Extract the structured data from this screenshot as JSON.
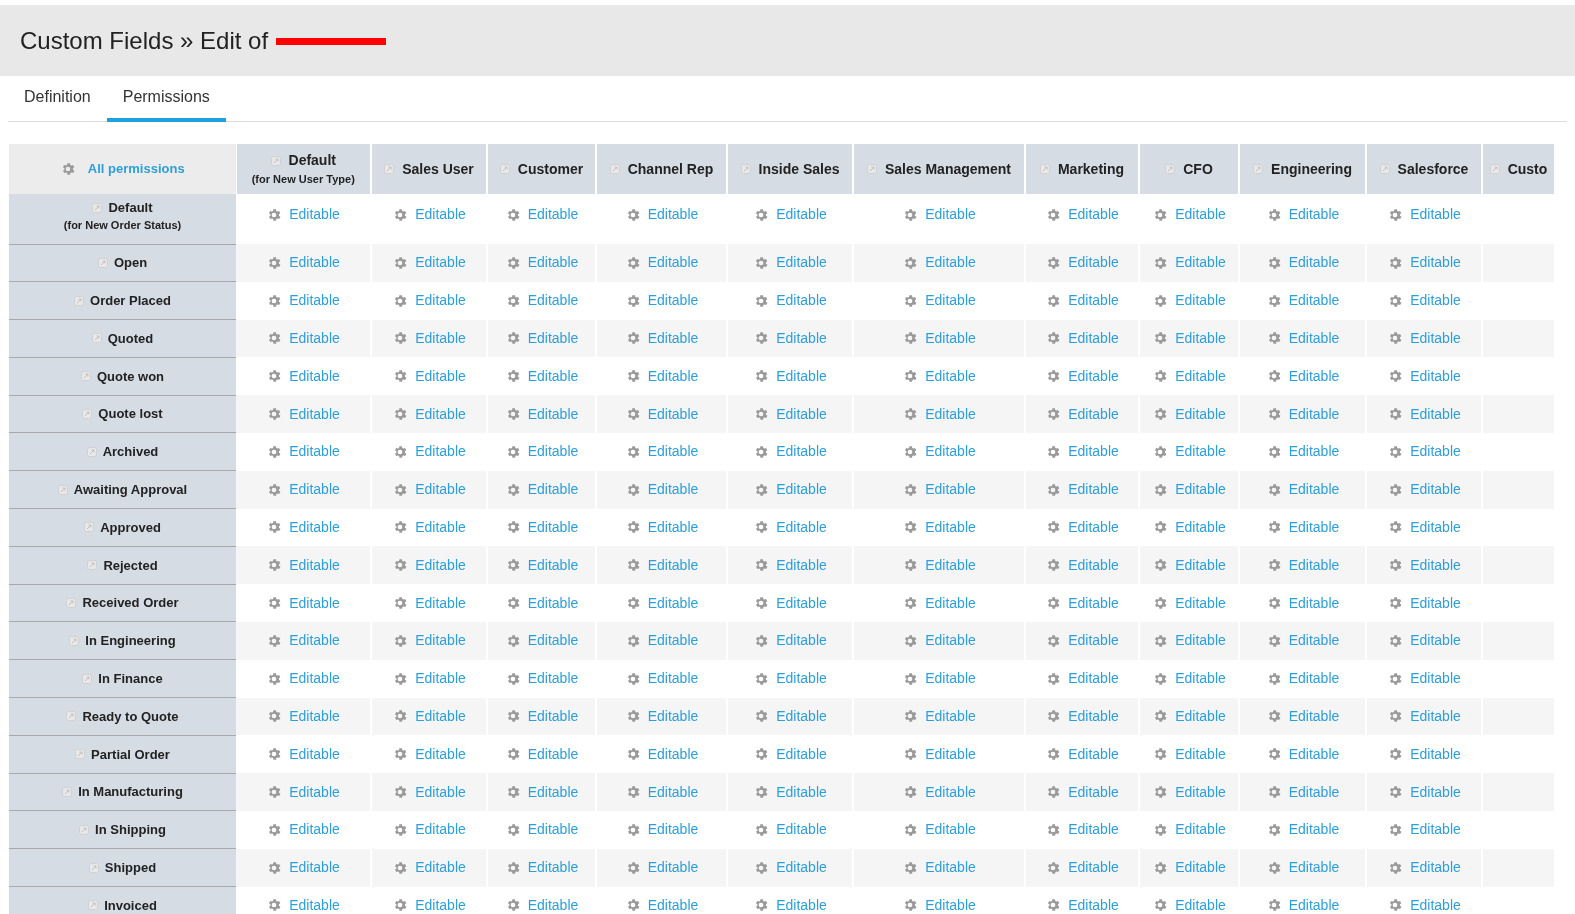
{
  "page_title": "Custom Fields » Edit of",
  "title_redacted": true,
  "tabs": [
    {
      "label": "Definition",
      "selected": false
    },
    {
      "label": "Permissions",
      "selected": true
    }
  ],
  "table": {
    "corner": "All permissions",
    "columns": [
      {
        "label": "Default",
        "sublabel": "(for New User Type)"
      },
      {
        "label": "Sales User"
      },
      {
        "label": "Customer"
      },
      {
        "label": "Channel Rep"
      },
      {
        "label": "Inside Sales"
      },
      {
        "label": "Sales Management"
      },
      {
        "label": "Marketing"
      },
      {
        "label": "CFO"
      },
      {
        "label": "Engineering"
      },
      {
        "label": "Salesforce"
      },
      {
        "label": "Custo"
      }
    ],
    "rows": [
      {
        "label": "Default",
        "sublabel": "(for New Order Status)",
        "cells": [
          "Editable",
          "Editable",
          "Editable",
          "Editable",
          "Editable",
          "Editable",
          "Editable",
          "Editable",
          "Editable",
          "Editable"
        ]
      },
      {
        "label": "Open",
        "cells": [
          "Editable",
          "Editable",
          "Editable",
          "Editable",
          "Editable",
          "Editable",
          "Editable",
          "Editable",
          "Editable",
          "Editable"
        ]
      },
      {
        "label": "Order Placed",
        "cells": [
          "Editable",
          "Editable",
          "Editable",
          "Editable",
          "Editable",
          "Editable",
          "Editable",
          "Editable",
          "Editable",
          "Editable"
        ]
      },
      {
        "label": "Quoted",
        "cells": [
          "Editable",
          "Editable",
          "Editable",
          "Editable",
          "Editable",
          "Editable",
          "Editable",
          "Editable",
          "Editable",
          "Editable"
        ]
      },
      {
        "label": "Quote won",
        "cells": [
          "Editable",
          "Editable",
          "Editable",
          "Editable",
          "Editable",
          "Editable",
          "Editable",
          "Editable",
          "Editable",
          "Editable"
        ]
      },
      {
        "label": "Quote lost",
        "cells": [
          "Editable",
          "Editable",
          "Editable",
          "Editable",
          "Editable",
          "Editable",
          "Editable",
          "Editable",
          "Editable",
          "Editable"
        ]
      },
      {
        "label": "Archived",
        "cells": [
          "Editable",
          "Editable",
          "Editable",
          "Editable",
          "Editable",
          "Editable",
          "Editable",
          "Editable",
          "Editable",
          "Editable"
        ]
      },
      {
        "label": "Awaiting Approval",
        "cells": [
          "Editable",
          "Editable",
          "Editable",
          "Editable",
          "Editable",
          "Editable",
          "Editable",
          "Editable",
          "Editable",
          "Editable"
        ]
      },
      {
        "label": "Approved",
        "cells": [
          "Editable",
          "Editable",
          "Editable",
          "Editable",
          "Editable",
          "Editable",
          "Editable",
          "Editable",
          "Editable",
          "Editable"
        ]
      },
      {
        "label": "Rejected",
        "cells": [
          "Editable",
          "Editable",
          "Editable",
          "Editable",
          "Editable",
          "Editable",
          "Editable",
          "Editable",
          "Editable",
          "Editable"
        ]
      },
      {
        "label": "Received Order",
        "cells": [
          "Editable",
          "Editable",
          "Editable",
          "Editable",
          "Editable",
          "Editable",
          "Editable",
          "Editable",
          "Editable",
          "Editable"
        ]
      },
      {
        "label": "In Engineering",
        "cells": [
          "Editable",
          "Editable",
          "Editable",
          "Editable",
          "Editable",
          "Editable",
          "Editable",
          "Editable",
          "Editable",
          "Editable"
        ]
      },
      {
        "label": "In Finance",
        "cells": [
          "Editable",
          "Editable",
          "Editable",
          "Editable",
          "Editable",
          "Editable",
          "Editable",
          "Editable",
          "Editable",
          "Editable"
        ]
      },
      {
        "label": "Ready to Quote",
        "cells": [
          "Editable",
          "Editable",
          "Editable",
          "Editable",
          "Editable",
          "Editable",
          "Editable",
          "Editable",
          "Editable",
          "Editable"
        ]
      },
      {
        "label": "Partial Order",
        "cells": [
          "Editable",
          "Editable",
          "Editable",
          "Editable",
          "Editable",
          "Editable",
          "Editable",
          "Editable",
          "Editable",
          "Editable"
        ]
      },
      {
        "label": "In Manufacturing",
        "cells": [
          "Editable",
          "Editable",
          "Editable",
          "Editable",
          "Editable",
          "Editable",
          "Editable",
          "Editable",
          "Editable",
          "Editable"
        ]
      },
      {
        "label": "In Shipping",
        "cells": [
          "Editable",
          "Editable",
          "Editable",
          "Editable",
          "Editable",
          "Editable",
          "Editable",
          "Editable",
          "Editable",
          "Editable"
        ]
      },
      {
        "label": "Shipped",
        "cells": [
          "Editable",
          "Editable",
          "Editable",
          "Editable",
          "Editable",
          "Editable",
          "Editable",
          "Editable",
          "Editable",
          "Editable"
        ]
      },
      {
        "label": "Invoiced",
        "cells": [
          "Editable",
          "Editable",
          "Editable",
          "Editable",
          "Editable",
          "Editable",
          "Editable",
          "Editable",
          "Editable",
          "Editable"
        ]
      }
    ]
  }
}
